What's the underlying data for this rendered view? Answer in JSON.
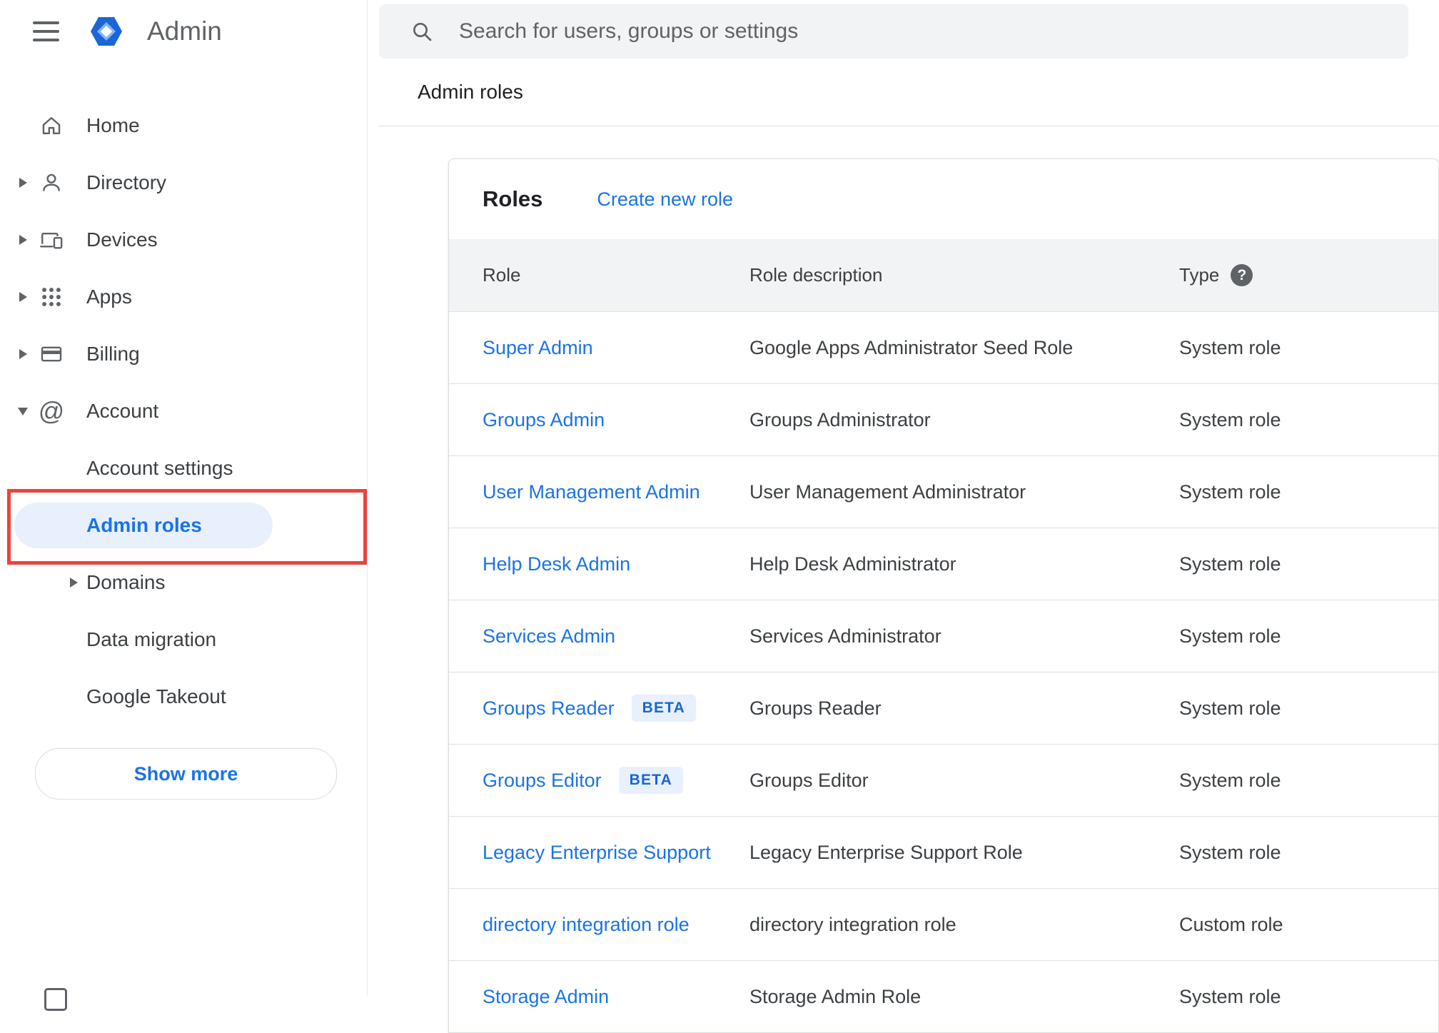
{
  "app": {
    "title": "Admin"
  },
  "search": {
    "placeholder": "Search for users, groups or settings"
  },
  "breadcrumb": {
    "current": "Admin roles"
  },
  "sidebar": {
    "items": [
      {
        "label": "Home"
      },
      {
        "label": "Directory"
      },
      {
        "label": "Devices"
      },
      {
        "label": "Apps"
      },
      {
        "label": "Billing"
      },
      {
        "label": "Account"
      },
      {
        "label": "Account settings"
      },
      {
        "label": "Admin roles"
      },
      {
        "label": "Domains"
      },
      {
        "label": "Data migration"
      },
      {
        "label": "Google Takeout"
      }
    ],
    "show_more_label": "Show more"
  },
  "roles": {
    "title": "Roles",
    "create_link": "Create new role",
    "columns": {
      "role": "Role",
      "description": "Role description",
      "type": "Type"
    },
    "rows": [
      {
        "role": "Super Admin",
        "description": "Google Apps Administrator Seed Role",
        "type": "System role"
      },
      {
        "role": "Groups Admin",
        "description": "Groups Administrator",
        "type": "System role"
      },
      {
        "role": "User Management Admin",
        "description": "User Management Administrator",
        "type": "System role"
      },
      {
        "role": "Help Desk Admin",
        "description": "Help Desk Administrator",
        "type": "System role"
      },
      {
        "role": "Services Admin",
        "description": "Services Administrator",
        "type": "System role"
      },
      {
        "role": "Groups Reader",
        "badge": "BETA",
        "description": "Groups Reader",
        "type": "System role"
      },
      {
        "role": "Groups Editor",
        "badge": "BETA",
        "description": "Groups Editor",
        "type": "System role"
      },
      {
        "role": "Legacy Enterprise Support",
        "description": "Legacy Enterprise Support Role",
        "type": "System role"
      },
      {
        "role": "directory integration role",
        "description": "directory integration role",
        "type": "Custom role"
      },
      {
        "role": "Storage Admin",
        "description": "Storage Admin Role",
        "type": "System role"
      }
    ]
  },
  "icons": {
    "help_glyph": "?",
    "account_glyph": "@"
  },
  "colors": {
    "link_blue": "#1a73e8",
    "selected_bg": "#e8f0fe",
    "badge_bg": "#e8f0fe",
    "badge_text": "#1967d2",
    "annotation_red": "#e8453c",
    "table_header_bg": "#f1f3f4",
    "icon_gray": "#5f6368"
  }
}
